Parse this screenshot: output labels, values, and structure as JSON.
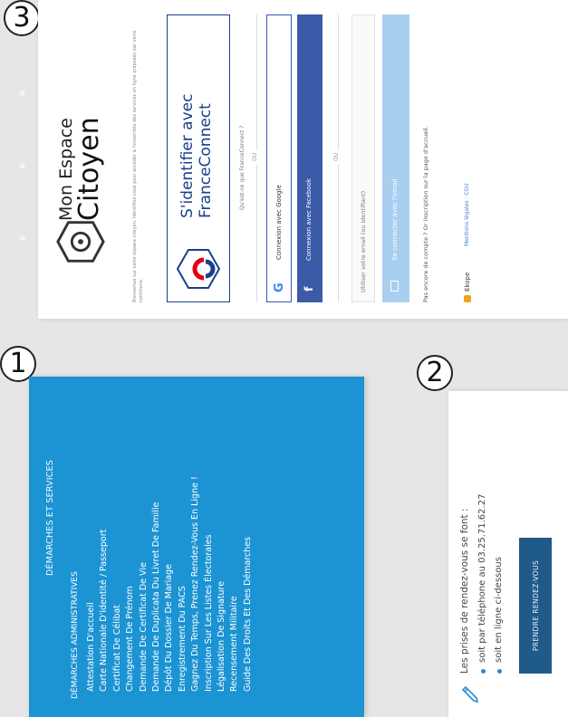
{
  "badges": {
    "one": "1",
    "two": "2",
    "three": "3"
  },
  "demarches_panel": {
    "title": "DÉMARCHES ET SERVICES",
    "subtitle": "DÉMARCHES ADMINISTRATIVES",
    "items": [
      "Attestation D'accueil",
      "Carte Nationale D'identité / Passeport",
      "Certificat De Célibat",
      "Changement De Prénom",
      "Demande De Certificat De Vie",
      "Demande De Duplicata Du Livret De Famille",
      "Dépôt Du Dossier De Mariage",
      "Enregistrement Du PACS",
      "Gagnez Du Temps, Prenez Rendez-Vous En Ligne !",
      "Inscription Sur Les Listes Électorales",
      "Légalisation De Signature",
      "Recensement Militaire",
      "Guide Des Droits Et Des Démarches"
    ]
  },
  "rendezvous_panel": {
    "intro": "Les prises de rendez-vous se font :",
    "option_phone": "soit par téléphone au 03.25.71.62.27",
    "option_online": "soit en ligne ci-dessous",
    "button_label": "PRENDRE RENDEZ-VOUS"
  },
  "login_panel": {
    "logo_line1": "Mon Espace",
    "logo_line2": "Citoyen",
    "intro_text": "Bienvenue sur votre espace citoyen. Identifiez-vous pour accéder à l'ensemble des services en ligne proposés par votre commune.",
    "franceconnect_line1": "S'identifier avec",
    "franceconnect_line2": "FranceConnect",
    "franceconnect_about": "Qu'est-ce que FranceConnect ?",
    "or_label_1": "OU",
    "google_button": "Connexion avec Google",
    "facebook_button": "Connexion avec Facebook",
    "or_label_2": "OU",
    "email_placeholder": "Utiliser votre email (ou identifiant)",
    "email_button": "Se connecter avec l'email",
    "no_account_text": "Pas encore de compte ? Or inscription sur la page d'accueil.",
    "footer_brand": "Ekope",
    "footer_legal": "Mentions légales · CGU"
  },
  "colors": {
    "menu_blue": "#1c93d3",
    "rdv_button": "#1f5a8b",
    "franceconnect_blue": "#1a3f8a",
    "facebook_blue": "#3b5ba8",
    "email_button": "#a9cff0"
  }
}
